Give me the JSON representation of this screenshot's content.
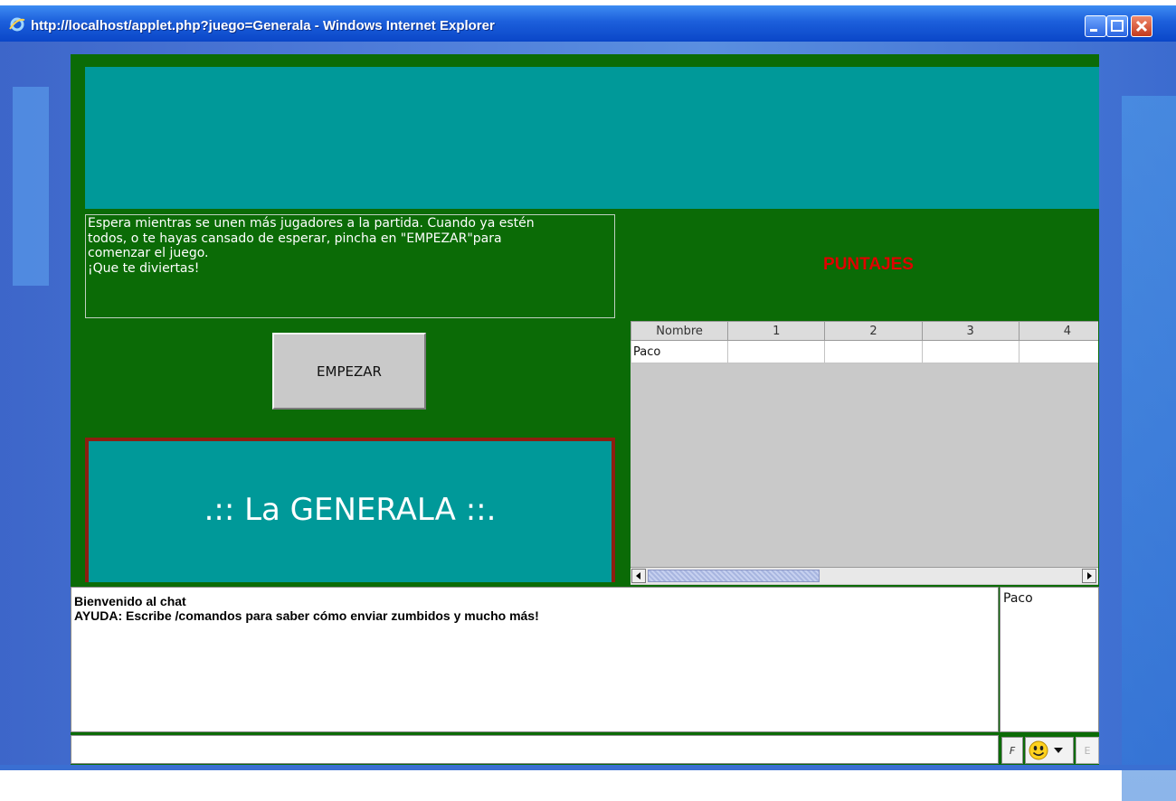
{
  "window": {
    "title": "http://localhost/applet.php?juego=Generala - Windows Internet Explorer"
  },
  "game": {
    "status_message": [
      "Espera mientras se unen más jugadores a la partida. Cuando ya estén",
      "todos, o te hayas cansado de esperar, pincha en \"EMPEZAR\"para",
      "comenzar el juego.",
      "¡Que te diviertas!"
    ],
    "start_button": "EMPEZAR",
    "title": ".:: La GENERALA ::."
  },
  "scores": {
    "heading": "PUNTAJES",
    "columns": [
      "Nombre",
      "1",
      "2",
      "3",
      "4"
    ],
    "rows": [
      [
        "Paco",
        "",
        "",
        "",
        ""
      ]
    ]
  },
  "chat": {
    "messages": [
      "Bienvenido al chat",
      " AYUDA: Escribe /comandos para saber cómo enviar zumbidos y mucho más!"
    ],
    "users": [
      "Paco"
    ],
    "input_value": "",
    "format_button": "F",
    "emoji_icon": "smiley-icon",
    "extra_button": "E"
  },
  "colors": {
    "applet_bg": "#0b6b06",
    "teal": "#009999",
    "puntajes": "#e00000",
    "title_border": "#8e1e10"
  }
}
